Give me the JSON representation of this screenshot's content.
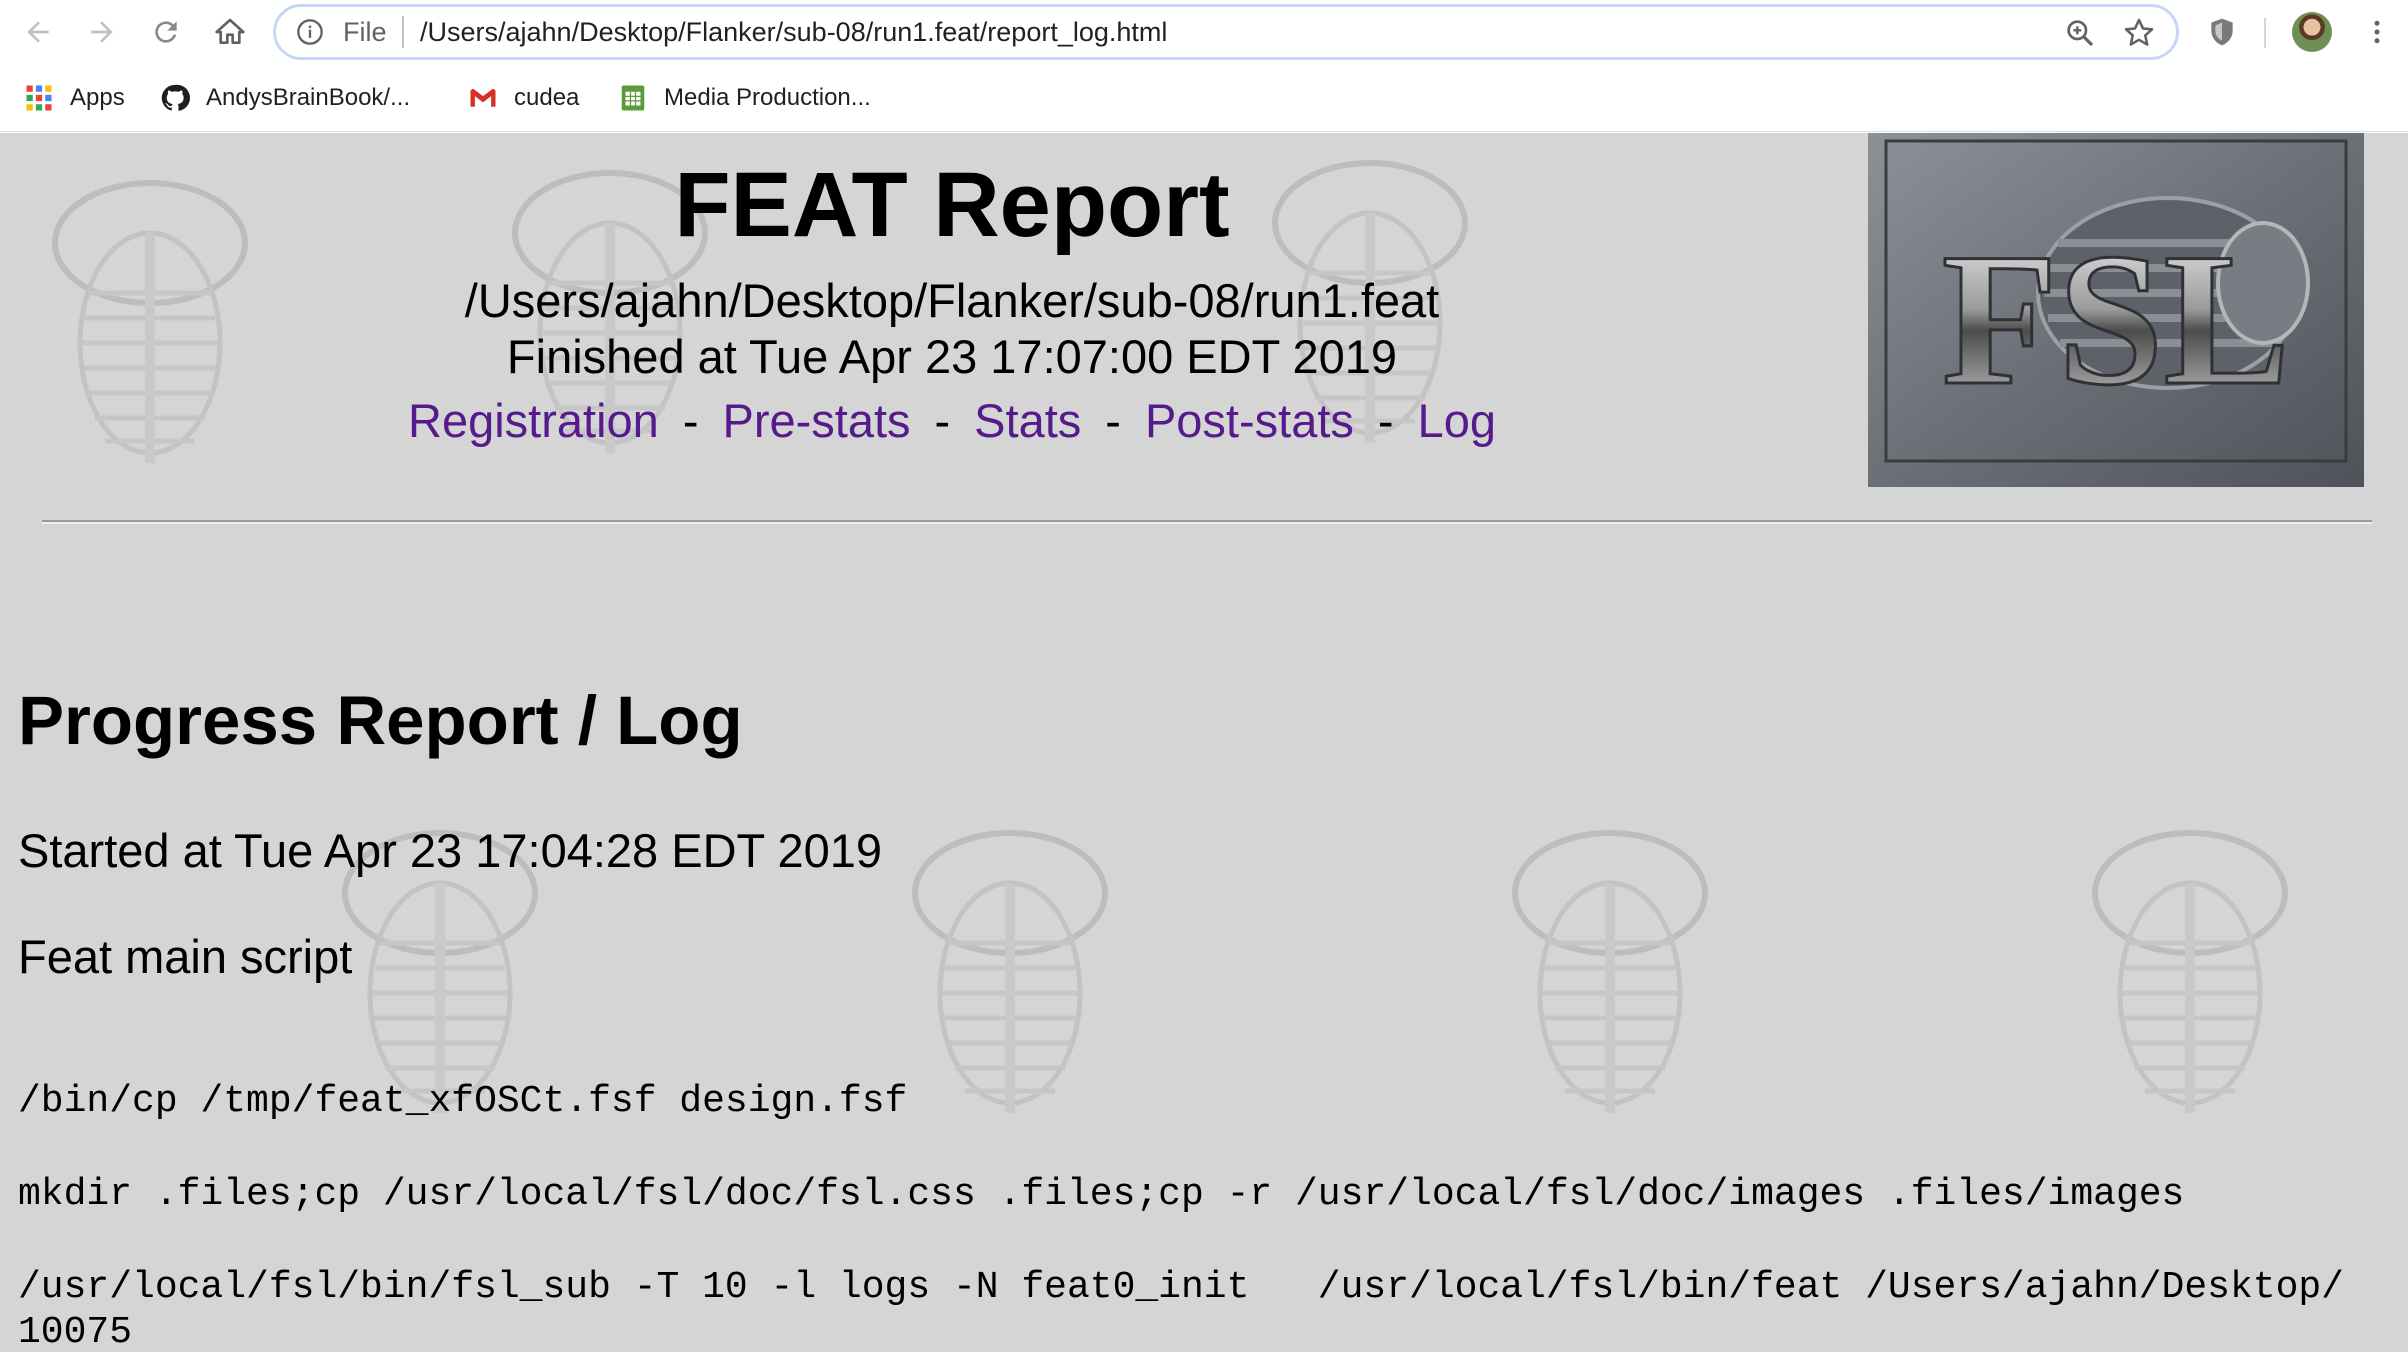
{
  "browser": {
    "address": {
      "scheme_label": "File",
      "url": "/Users/ajahn/Desktop/Flanker/sub-08/run1.feat/report_log.html"
    },
    "nav_icons": [
      "back-icon",
      "forward-icon",
      "reload-icon",
      "home-icon"
    ],
    "bookmarks": [
      {
        "label": "Apps",
        "icon": "apps-grid-icon"
      },
      {
        "label": "AndysBrainBook/...",
        "icon": "github-icon"
      },
      {
        "label": "cudea",
        "icon": "gmail-icon"
      },
      {
        "label": "Media Production...",
        "icon": "sheets-icon"
      }
    ]
  },
  "report": {
    "title": "FEAT Report",
    "path": "/Users/ajahn/Desktop/Flanker/sub-08/run1.feat",
    "finished": "Finished at Tue Apr 23 17:07:00 EDT 2019",
    "nav": [
      "Registration",
      "Pre-stats",
      "Stats",
      "Post-stats",
      "Log"
    ],
    "nav_separator": "-",
    "logo_text": "FSL",
    "link_color": "#551a8b",
    "background_color": "#d5d5d5"
  },
  "log": {
    "heading": "Progress Report / Log",
    "started": "Started at Tue Apr 23 17:04:28 EDT 2019",
    "section": "Feat main script",
    "commands": [
      "/bin/cp /tmp/feat_xfOSCt.fsf design.fsf",
      "mkdir .files;cp /usr/local/fsl/doc/fsl.css .files;cp -r /usr/local/fsl/doc/images .files/images",
      "/usr/local/fsl/bin/fsl_sub -T 10 -l logs -N feat0_init   /usr/local/fsl/bin/feat /Users/ajahn/Desktop/",
      "10075"
    ]
  }
}
